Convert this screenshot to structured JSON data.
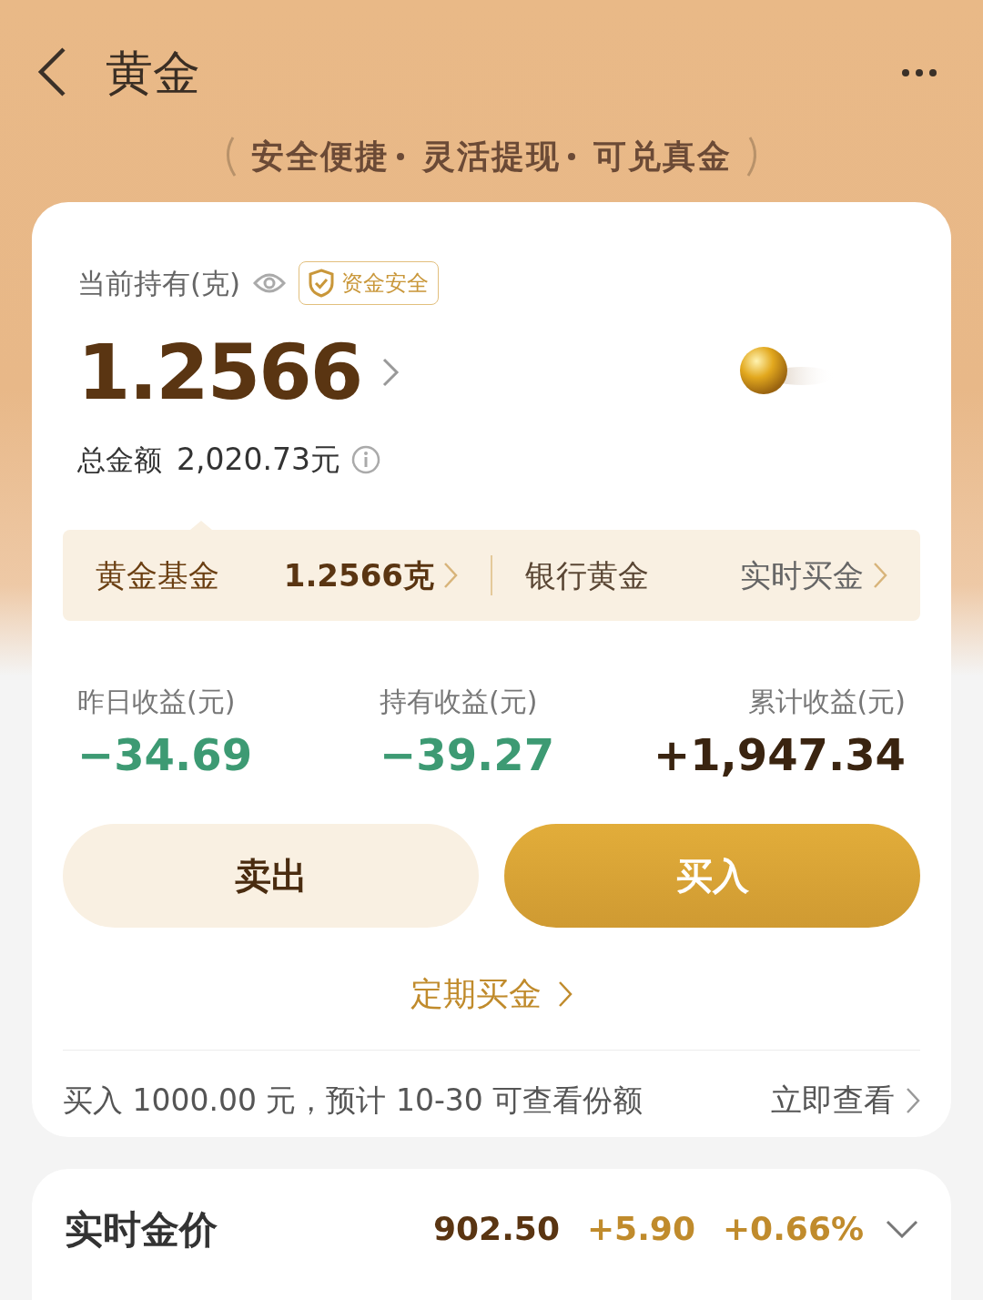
{
  "header": {
    "title": "黄金",
    "slogan": [
      "安全便捷",
      "灵活提现",
      "可兑真金"
    ]
  },
  "holding": {
    "label": "当前持有(克)",
    "badge": "资金安全",
    "amount": "1.2566",
    "total_label": "总金额",
    "total_value": "2,020.73元"
  },
  "segments": [
    {
      "name": "黄金基金",
      "value": "1.2566克",
      "selected": true
    },
    {
      "name": "银行黄金",
      "value": "实时买金",
      "selected": false
    }
  ],
  "earnings": [
    {
      "label": "昨日收益(元)",
      "value": "−34.69",
      "color": "#3d9a73"
    },
    {
      "label": "持有收益(元)",
      "value": "−39.27",
      "color": "#3d9a73"
    },
    {
      "label": "累计收益(元)",
      "value": "+1,947.34",
      "color": "#3a2410"
    }
  ],
  "buttons": [
    {
      "label": "卖出",
      "kind": "secondary"
    },
    {
      "label": "买入",
      "kind": "primary"
    }
  ],
  "plan_link": "定期买金",
  "notice": {
    "text": "买入 1000.00 元，预计 10-30 可查看份额",
    "action": "立即查看"
  },
  "price": {
    "title": "实时金价",
    "value": "902.50",
    "change": "+5.90",
    "percent": "+0.66%"
  }
}
